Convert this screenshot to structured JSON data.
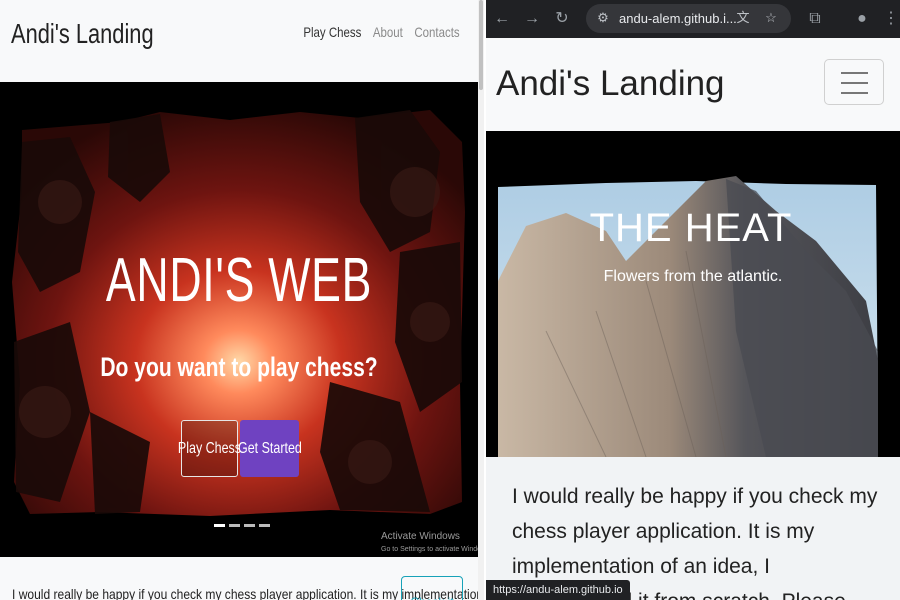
{
  "left": {
    "brand": "Andi's Landing",
    "nav_links": [
      "Play Chess",
      "About",
      "Contacts"
    ],
    "hero": {
      "title": "ANDI'S WEB",
      "subtitle": "Do you want to play chess?",
      "btn_play": "Play Chess",
      "btn_start": "Get Started",
      "indicator_count": 4,
      "indicator_active": 0
    },
    "watermark": {
      "line1": "Activate Windows",
      "line2": "Go to Settings to activate Windows."
    },
    "paragraph": "I would really be happy if you check my chess player application. It is my implementation of",
    "check_button": "Check it out"
  },
  "browser": {
    "url": "andu-alem.github.i...",
    "status_url": "https://andu-alem.github.io",
    "icons": [
      "back-icon",
      "forward-icon",
      "reload-icon",
      "site-info-icon",
      "translate-icon",
      "star-icon",
      "extensions-icon",
      "profile-icon",
      "menu-icon"
    ]
  },
  "right": {
    "brand": "Andi's Landing",
    "hero": {
      "title": "THE HEAT",
      "subtitle": "Flowers from the atlantic."
    },
    "paragraph": "I would really be happy if you check my chess player application. It is my implementation of an idea, I implemented it from scratch. Please"
  },
  "colors": {
    "primary_button": "#6f42c1",
    "check_outline": "#17a2b8",
    "browser_toolbar": "#202124",
    "navbar": "#f8f9fa"
  }
}
